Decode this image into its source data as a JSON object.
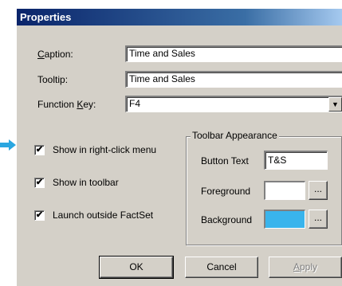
{
  "dialog": {
    "title": "Properties",
    "caption": {
      "label_prefix": "",
      "label_key": "C",
      "label_rest": "aption:",
      "value": "Time and Sales"
    },
    "tooltip": {
      "label": "Tooltip:",
      "value": "Time and Sales"
    },
    "function_key": {
      "label_prefix": "Function ",
      "label_key": "K",
      "label_rest": "ey:",
      "value": "F4"
    },
    "checkboxes": [
      {
        "label": "Show in right-click menu",
        "checked": true
      },
      {
        "label": "Show in toolbar",
        "checked": true
      },
      {
        "label": "Launch outside FactSet",
        "checked": true
      }
    ],
    "toolbar_appearance": {
      "title": "Toolbar Appearance",
      "button_text_label": "Button Text",
      "button_text_value": "T&S",
      "foreground_label": "Foreground",
      "foreground_color": "#ffffff",
      "background_label": "Background",
      "background_color": "#39b4ec",
      "ellipsis": "..."
    },
    "buttons": {
      "ok": "OK",
      "cancel": "Cancel",
      "apply_key": "A",
      "apply_rest": "pply"
    },
    "check_mark": "✔",
    "combo_arrow": "▼"
  },
  "colors": {
    "accent_arrow": "#2aa6e0",
    "title_bar": "#0a246a",
    "face": "#d4d0c8"
  }
}
